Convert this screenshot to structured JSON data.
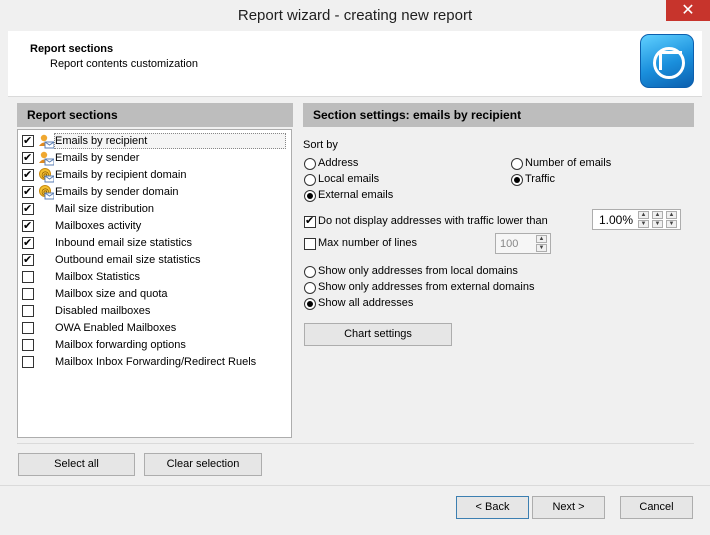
{
  "window": {
    "title": "Report wizard - creating new report",
    "close_glyph": "✕"
  },
  "header": {
    "title": "Report sections",
    "subtitle": "Report contents customization",
    "logo_icon": "wizard-logo-icon"
  },
  "left_panel": {
    "header": "Report sections",
    "items": [
      {
        "label": "Emails by recipient",
        "checked": true,
        "icon": "person-envelope-icon"
      },
      {
        "label": "Emails by sender",
        "checked": true,
        "icon": "person-envelope-icon"
      },
      {
        "label": "Emails by recipient domain",
        "checked": true,
        "icon": "at-envelope-icon"
      },
      {
        "label": "Emails by sender domain",
        "checked": true,
        "icon": "at-envelope-icon"
      },
      {
        "label": "Mail size distribution",
        "checked": true,
        "icon": ""
      },
      {
        "label": "Mailboxes activity",
        "checked": true,
        "icon": ""
      },
      {
        "label": "Inbound email size statistics",
        "checked": true,
        "icon": ""
      },
      {
        "label": "Outbound email size statistics",
        "checked": true,
        "icon": ""
      },
      {
        "label": "Mailbox Statistics",
        "checked": false,
        "icon": ""
      },
      {
        "label": "Mailbox size and quota",
        "checked": false,
        "icon": ""
      },
      {
        "label": "Disabled mailboxes",
        "checked": false,
        "icon": ""
      },
      {
        "label": "OWA Enabled Mailboxes",
        "checked": false,
        "icon": ""
      },
      {
        "label": "Mailbox forwarding options",
        "checked": false,
        "icon": ""
      },
      {
        "label": "Mailbox Inbox Forwarding/Redirect Ruels",
        "checked": false,
        "icon": ""
      }
    ],
    "select_all": "Select all",
    "clear_selection": "Clear selection"
  },
  "right_panel": {
    "header": "Section settings: emails by recipient",
    "sort_by": "Sort by",
    "sort_options": {
      "address": "Address",
      "local_emails": "Local emails",
      "external_emails": "External emails",
      "number_of_emails": "Number of emails",
      "traffic": "Traffic",
      "selected": "traffic",
      "group2_selected": "external_emails"
    },
    "hide_low_traffic": {
      "label": "Do not display addresses with traffic lower than",
      "checked": true,
      "value": "1.00%"
    },
    "max_lines": {
      "label": "Max number of lines",
      "checked": false,
      "value": "100"
    },
    "domain_filter": {
      "local": "Show only addresses from local domains",
      "external": "Show only addresses from external domains",
      "all": "Show all addresses",
      "selected": "all"
    },
    "chart_settings": "Chart settings"
  },
  "footer": {
    "back": "< Back",
    "next": "Next >",
    "cancel": "Cancel"
  },
  "colors": {
    "close_red": "#c7342c",
    "panel_header": "#bdbdbd",
    "default_border": "#3c7fb1"
  }
}
